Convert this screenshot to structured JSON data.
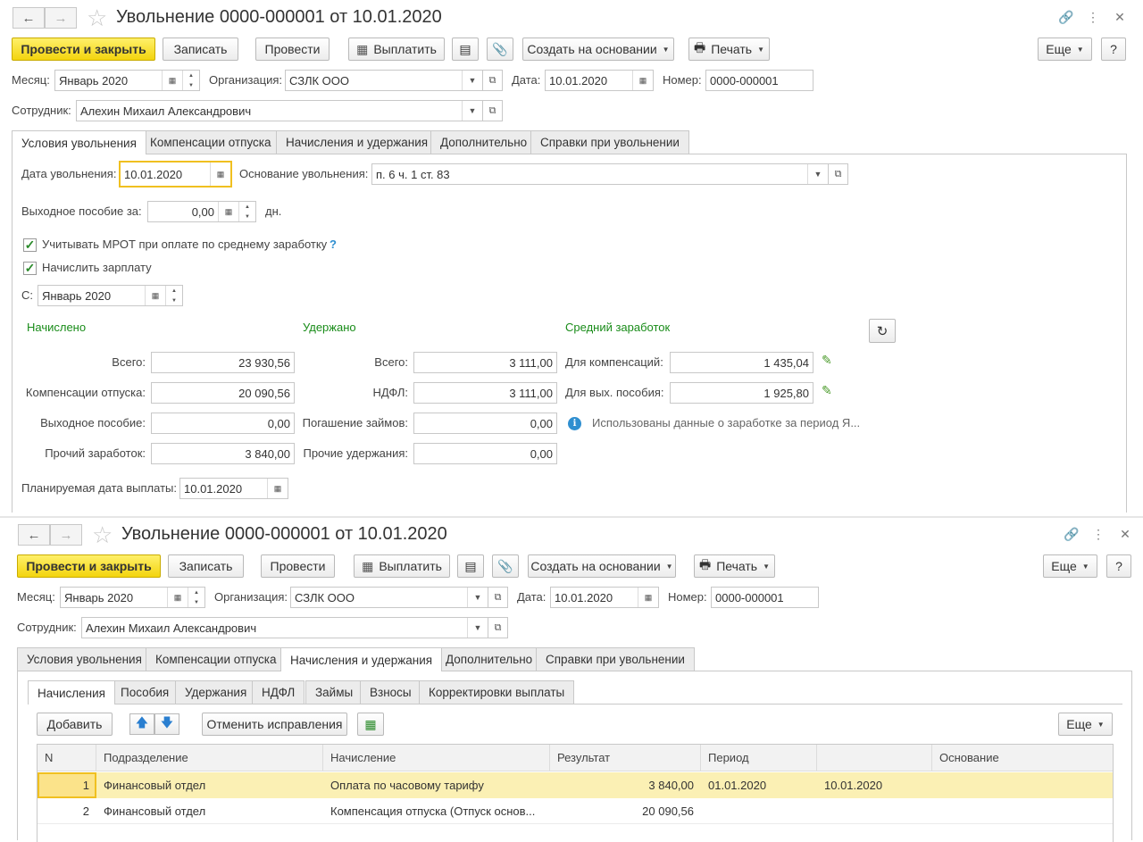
{
  "doc_title": "Увольнение 0000-000001 от 10.01.2020",
  "toolbar": {
    "post_close": "Провести и закрыть",
    "save": "Записать",
    "post": "Провести",
    "pay": "Выплатить",
    "create_based": "Создать на основании",
    "print": "Печать",
    "more": "Еще",
    "help": "?"
  },
  "header": {
    "month_label": "Месяц:",
    "month_value": "Январь 2020",
    "org_label": "Организация:",
    "org_value": "СЗЛК ООО",
    "date_label": "Дата:",
    "date_value": "10.01.2020",
    "number_label": "Номер:",
    "number_value": "0000-000001",
    "employee_label": "Сотрудник:",
    "employee_value": "Алехин Михаил Александрович"
  },
  "tabs": [
    "Условия увольнения",
    "Компенсации отпуска",
    "Начисления и удержания",
    "Дополнительно",
    "Справки при увольнении"
  ],
  "conditions": {
    "dismissal_date_label": "Дата увольнения:",
    "dismissal_date_value": "10.01.2020",
    "reason_label": "Основание увольнения:",
    "reason_value": "п. 6 ч. 1 ст. 83",
    "severance_label": "Выходное пособие за:",
    "severance_value": "0,00",
    "severance_unit": "дн.",
    "mrot_label": "Учитывать МРОТ при оплате по среднему заработку",
    "mrot_help": "?",
    "salary_label": "Начислить зарплату",
    "from_label": "С:",
    "from_value": "Январь 2020",
    "accrued_title": "Начислено",
    "withheld_title": "Удержано",
    "avg_title": "Средний заработок",
    "accrued": {
      "total_label": "Всего:",
      "total_value": "23 930,56",
      "vac_comp_label": "Компенсации отпуска:",
      "vac_comp_value": "20 090,56",
      "severance_label": "Выходное пособие:",
      "severance_value": "0,00",
      "other_label": "Прочий заработок:",
      "other_value": "3 840,00"
    },
    "withheld": {
      "total_label": "Всего:",
      "total_value": "3 111,00",
      "ndfl_label": "НДФЛ:",
      "ndfl_value": "3 111,00",
      "loans_label": "Погашение займов:",
      "loans_value": "0,00",
      "other_label": "Прочие удержания:",
      "other_value": "0,00"
    },
    "avg": {
      "comp_label": "Для компенсаций:",
      "comp_value": "1 435,04",
      "sev_label": "Для вых. пособия:",
      "sev_value": "1 925,80",
      "info": "Использованы данные о заработке за период Я..."
    },
    "pay_date_label": "Планируемая дата выплаты:",
    "pay_date_value": "10.01.2020"
  },
  "subtabs": [
    "Начисления",
    "Пособия",
    "Удержания",
    "НДФЛ",
    "Займы",
    "Взносы",
    "Корректировки выплаты"
  ],
  "grid_toolbar": {
    "add": "Добавить",
    "cancel_corrections": "Отменить исправления",
    "more": "Еще"
  },
  "grid": {
    "columns": [
      "N",
      "Подразделение",
      "Начисление",
      "Результат",
      "Период",
      "",
      "Основание"
    ],
    "rows": [
      [
        "1",
        "Финансовый отдел",
        "Оплата по часовому тарифу",
        "3 840,00",
        "01.01.2020",
        "10.01.2020",
        ""
      ],
      [
        "2",
        "Финансовый отдел",
        "Компенсация отпуска (Отпуск основ...",
        "20 090,56",
        "",
        "",
        ""
      ]
    ]
  },
  "colors": {
    "primary_button": "#f3d40e",
    "selected_row": "#fbf0b4",
    "section_title": "#198c19",
    "focus_border": "#f0c020"
  }
}
